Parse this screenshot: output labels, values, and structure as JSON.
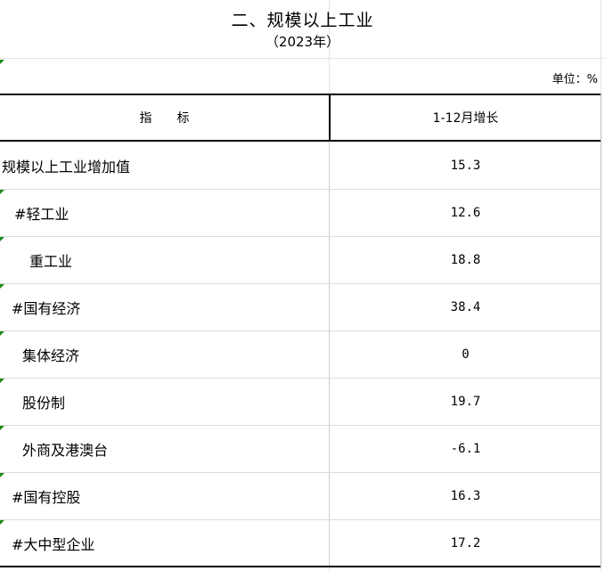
{
  "title": "二、规模以上工业",
  "subtitle": "（2023年）",
  "unit": "单位：%",
  "header": {
    "indicator": "指　　标",
    "growth": "1-12月增长"
  },
  "rows": [
    {
      "label": "规模以上工业增加值",
      "value": "15.3"
    },
    {
      "label": "#轻工业",
      "value": "12.6"
    },
    {
      "label": "重工业",
      "value": "18.8"
    },
    {
      "label": "#国有经济",
      "value": "38.4"
    },
    {
      "label": "集体经济",
      "value": "0"
    },
    {
      "label": "股份制",
      "value": "19.7"
    },
    {
      "label": "外商及港澳台",
      "value": "-6.1"
    },
    {
      "label": "#国有控股",
      "value": "16.3"
    },
    {
      "label": "#大中型企业",
      "value": "17.2"
    }
  ],
  "colors": {
    "marker": "#1a8a1a",
    "rule": "#000000"
  }
}
